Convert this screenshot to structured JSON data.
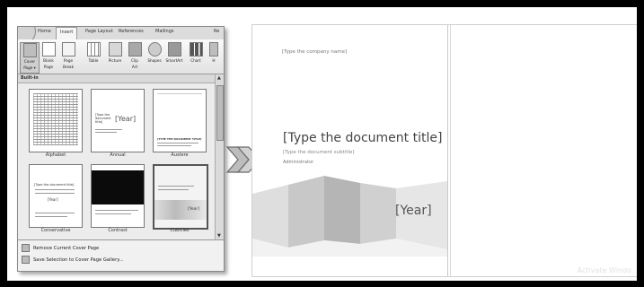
{
  "ribbon": {
    "tabs": [
      "Home",
      "Insert",
      "Page Layout",
      "References",
      "Mailings",
      "Re"
    ],
    "active_tab": "Insert",
    "buttons": [
      {
        "label1": "Cover",
        "label2": "Page ▾",
        "icon": "cover-page-icon"
      },
      {
        "label1": "Blank",
        "label2": "Page",
        "icon": "blank-page-icon"
      },
      {
        "label1": "Page",
        "label2": "Break",
        "icon": "page-break-icon"
      },
      {
        "label1": "Table",
        "label2": "",
        "icon": "table-icon"
      },
      {
        "label1": "Picture",
        "label2": "",
        "icon": "picture-icon"
      },
      {
        "label1": "Clip",
        "label2": "Art",
        "icon": "clip-art-icon"
      },
      {
        "label1": "Shapes",
        "label2": "",
        "icon": "shapes-icon"
      },
      {
        "label1": "SmartArt",
        "label2": "",
        "icon": "smartart-icon"
      },
      {
        "label1": "Chart",
        "label2": "",
        "icon": "chart-icon"
      },
      {
        "label1": "H",
        "label2": "",
        "icon": "hyperlink-icon"
      }
    ]
  },
  "gallery": {
    "header": "Built-in",
    "cards": [
      {
        "name": "Alphabet"
      },
      {
        "name": "Annual",
        "mini_year": "[Year]",
        "mini_title": "[Type the document title]"
      },
      {
        "name": "Austere",
        "mini_title": "[TYPE THE DOCUMENT TITLE]"
      },
      {
        "name": "Conservative",
        "mini_title": "[Type the document title]",
        "mini_year": "[Year]"
      },
      {
        "name": "Contrast"
      },
      {
        "name": "Cubicles",
        "mini_year": "[Year]"
      }
    ]
  },
  "menu": {
    "remove": "Remove Current Cover Page",
    "save": "Save Selection to Cover Page Gallery..."
  },
  "document": {
    "company": "[Type the company name]",
    "title": "[Type the document title]",
    "subtitle": "[Type the document subtitle]",
    "author": "Administrator",
    "year": "[Year]",
    "watermark": "Activate Windo"
  }
}
